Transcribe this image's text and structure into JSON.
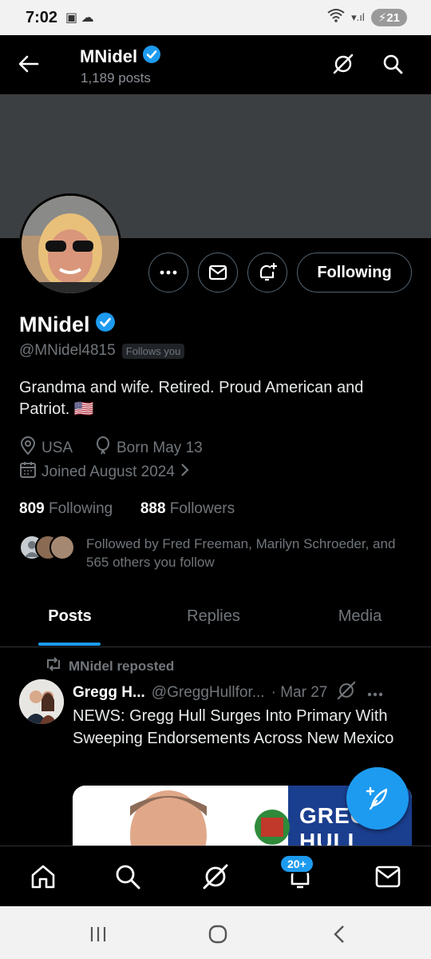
{
  "status_bar": {
    "time": "7:02",
    "left_icons": "▣ ☁",
    "battery": "21",
    "signal": "▾.ıl"
  },
  "header": {
    "title": "MNidel",
    "posts_count": "1,189 posts"
  },
  "profile": {
    "name": "MNidel",
    "handle": "@MNidel4815",
    "follows_you": "Follows you",
    "bio": "Grandma and wife. Retired. Proud American and Patriot. 🇺🇸",
    "location": "USA",
    "born": "Born May 13",
    "joined": "Joined August 2024",
    "following_count": "809",
    "following_label": "Following",
    "followers_count": "888",
    "followers_label": "Followers",
    "followed_by": "Followed by Fred Freeman, Marilyn Schroeder, and 565 others you follow"
  },
  "actions": {
    "following_button": "Following"
  },
  "tabs": [
    {
      "label": "Posts"
    },
    {
      "label": "Replies"
    },
    {
      "label": "Media"
    }
  ],
  "post": {
    "repost_label": "MNidel reposted",
    "author_name": "Gregg H...",
    "author_handle": "@GreggHullfor...",
    "date": "· Mar 27",
    "text": "NEWS: Gregg Hull Surges Into Primary With Sweeping Endorsements Across New Mexico",
    "card_text": "GREGG HULL"
  },
  "bottom_nav": {
    "notif_badge": "20+"
  },
  "colors": {
    "accent": "#1d9bf0",
    "background": "#000000",
    "muted": "#71767b",
    "banner": "#3c3f41"
  }
}
